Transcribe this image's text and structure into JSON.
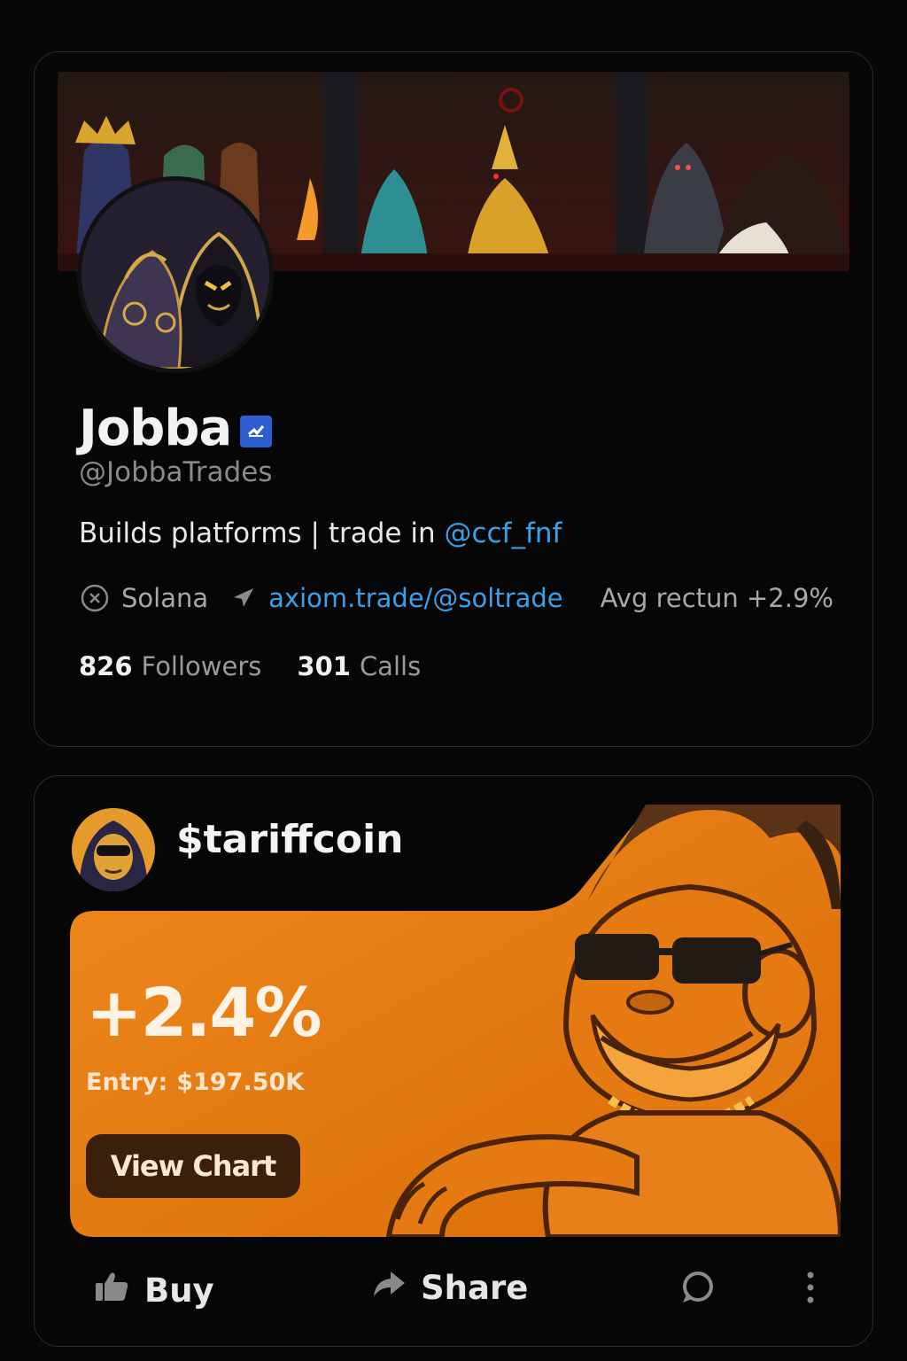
{
  "profile": {
    "display_name": "Jobba",
    "handle": "@JobbaTrades",
    "bio_text": "Builds platforms | trade in ",
    "bio_mention": "@ccf_fnf",
    "chain": "Solana",
    "link": "axiom.trade/@soltrade",
    "avg_return": "Avg rectun +2.9%",
    "followers_count": "826",
    "followers_label": "Followers",
    "calls_count": "301",
    "calls_label": "Calls",
    "icons": {
      "chain": "close-circle-icon",
      "link": "send-arrow-icon",
      "verified": "verified-badge-icon"
    }
  },
  "token": {
    "name": "$tariffcoin",
    "change": "+2.4%",
    "entry_label": "Entry:",
    "entry_value": "$197.50K",
    "view_chart_label": "View Chart"
  },
  "actions": {
    "buy_label": "Buy",
    "share_label": "Share",
    "icons": [
      "thumbs-up-icon",
      "share-arrow-icon",
      "comment-icon",
      "more-vertical-icon"
    ]
  },
  "colors": {
    "accent_link": "#3aa0ea",
    "verified": "#2d5fd1",
    "promo_orange": "#e8780e",
    "button_dark": "#3b1f0d"
  }
}
